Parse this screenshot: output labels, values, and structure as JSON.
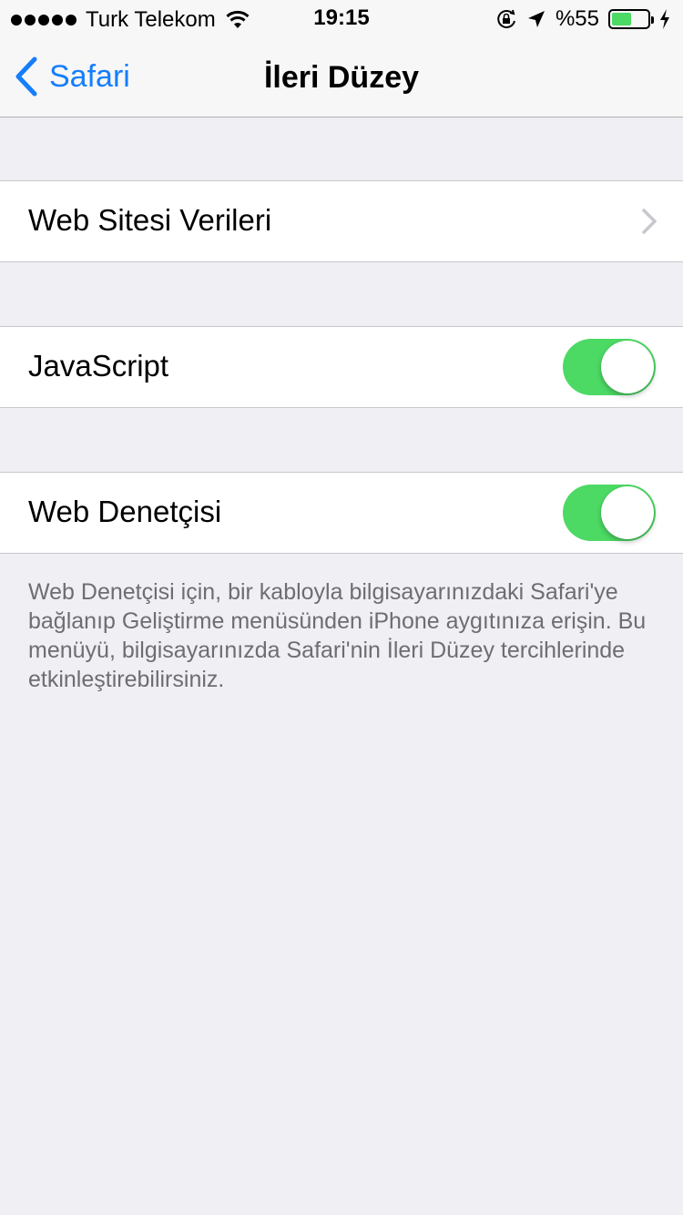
{
  "status_bar": {
    "carrier": "Turk Telekom",
    "time": "19:15",
    "battery_percent": "%55",
    "battery_level": 0.55,
    "icons": [
      "signal-dots-icon",
      "wifi-icon",
      "orientation-lock-icon",
      "location-arrow-icon",
      "battery-icon",
      "charging-bolt-icon"
    ]
  },
  "nav": {
    "back_label": "Safari",
    "title": "İleri Düzey"
  },
  "cells": {
    "website_data": "Web Sitesi Verileri",
    "javascript": "JavaScript",
    "javascript_on": true,
    "web_inspector": "Web Denetçisi",
    "web_inspector_on": true
  },
  "footer": "Web Denetçisi için, bir kabloyla bilgisayarınızdaki Safari'ye bağlanıp Geliştirme menüsünden iPhone aygıtınıza erişin. Bu menüyü, bilgisayarınızda Safari'nin İleri Düzey tercihlerinde etkinleştirebilirsiniz.",
  "colors": {
    "accent": "#157efb",
    "toggle_on": "#4cd964",
    "background": "#efeff4"
  }
}
